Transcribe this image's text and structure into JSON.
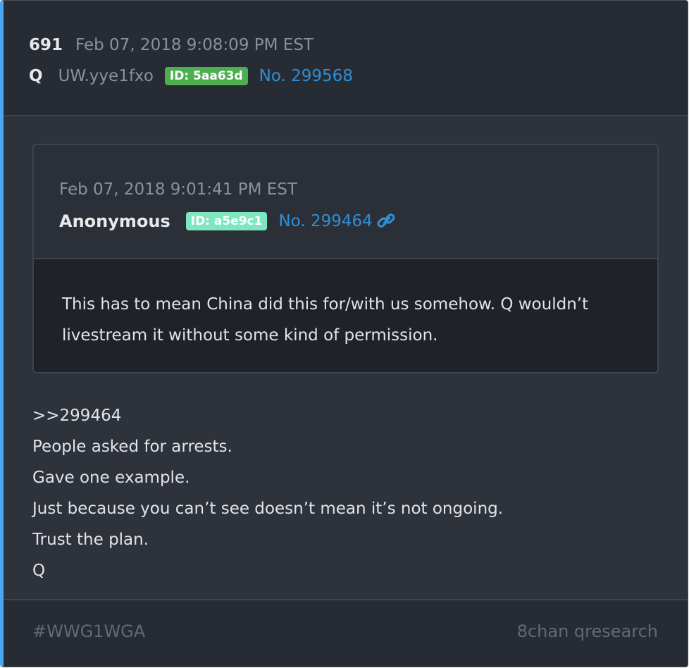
{
  "post": {
    "number": "691",
    "timestamp": "Feb 07, 2018 9:08:09 PM EST",
    "author": "Q",
    "tripcode": "UW.yye1fxo",
    "id_badge": "ID: 5aa63d",
    "post_no": "No. 299568"
  },
  "quoted": {
    "timestamp": "Feb 07, 2018 9:01:41 PM EST",
    "author": "Anonymous",
    "id_badge": "ID: a5e9c1",
    "post_no": "No. 299464",
    "link_icon": "link-icon",
    "text": "This has to mean China did this for/with us somehow.  Q wouldn’t livestream it without some kind of permission."
  },
  "body": {
    "lines": [
      ">>299464",
      "People asked for arrests.",
      "Gave one example.",
      "Just because you can’t see doesn’t mean it’s not ongoing.",
      "Trust the plan.",
      "Q"
    ]
  },
  "footer": {
    "tag": "#WWG1WGA",
    "source": "8chan qresearch"
  },
  "colors": {
    "accent_border": "#4ba6f0",
    "id_green": "#4caf50",
    "id_teal": "#7ee6c0",
    "link_blue": "#2e8fd6"
  }
}
